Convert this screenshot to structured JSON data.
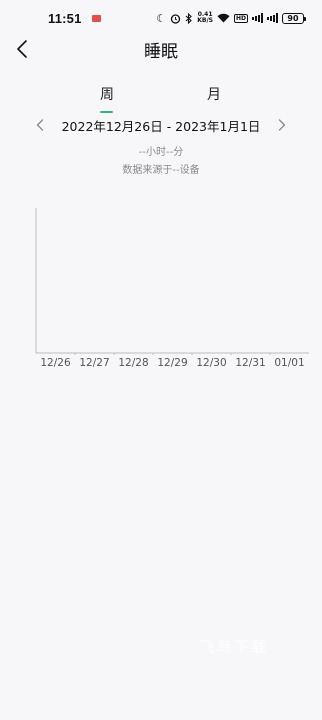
{
  "status_bar": {
    "time": "11:51",
    "net_speed_value": "0.41",
    "net_speed_unit": "KB/S",
    "hd_badge": "HD",
    "battery": "90"
  },
  "header": {
    "title": "睡眠"
  },
  "tabs": [
    {
      "label": "周",
      "selected": true
    },
    {
      "label": "月",
      "selected": false
    }
  ],
  "date_range": "2022年12月26日 - 2023年1月1日",
  "summary": {
    "duration": "--小时--分",
    "source": "数据来源于--设备"
  },
  "chart_data": {
    "type": "bar",
    "categories": [
      "12/26",
      "12/27",
      "12/28",
      "12/29",
      "12/30",
      "12/31",
      "01/01"
    ],
    "series": [],
    "title": "",
    "xlabel": "",
    "ylabel": ""
  },
  "colors": {
    "accent": "#2fb87a",
    "background": "#f7f6f8",
    "axis": "#bdbdbd"
  },
  "watermark": "飞鸟下载"
}
